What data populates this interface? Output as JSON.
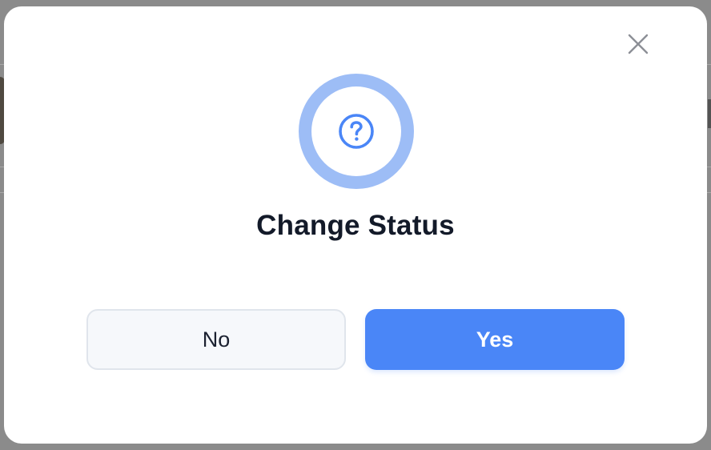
{
  "dialog": {
    "title": "Change Status",
    "no_label": "No",
    "yes_label": "Yes",
    "close_icon": "close-icon",
    "status_icon": "question-circle-icon"
  },
  "colors": {
    "accent": "#4a86f7",
    "ring": "#9dbdf6",
    "title_text": "#131a29",
    "no_button_bg": "#f6f8fb",
    "no_button_border": "#e0e5ec",
    "backdrop": "#8b8b8b"
  }
}
